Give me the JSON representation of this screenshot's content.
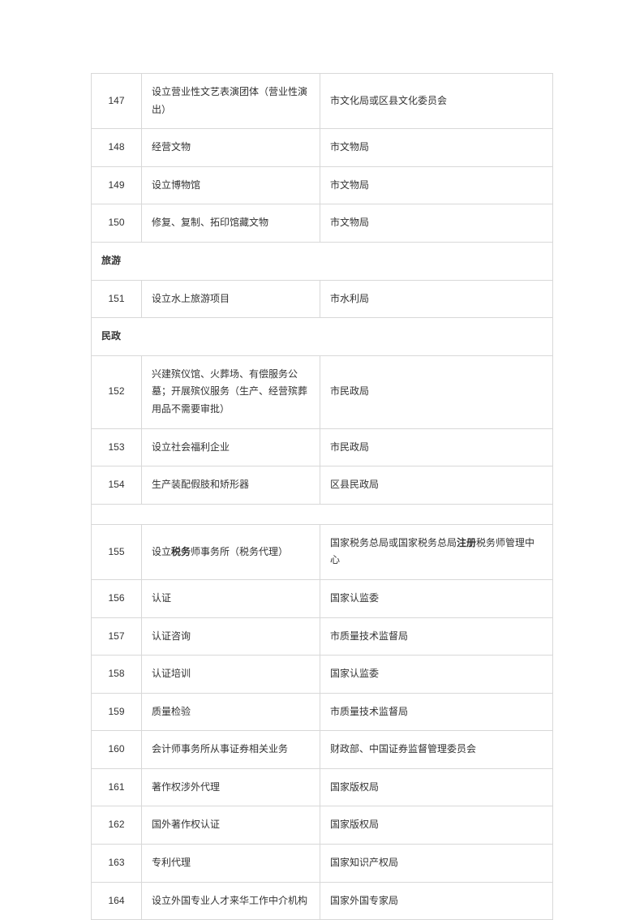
{
  "rows": [
    {
      "type": "data",
      "num": "147",
      "desc_parts": [
        {
          "t": "设立营业性文艺表演团体（营业性演出）"
        }
      ],
      "org_parts": [
        {
          "t": "市文化局或区县文化委员会"
        }
      ]
    },
    {
      "type": "data",
      "num": "148",
      "desc_parts": [
        {
          "t": "经营文物"
        }
      ],
      "org_parts": [
        {
          "t": "市文物局"
        }
      ]
    },
    {
      "type": "data",
      "num": "149",
      "desc_parts": [
        {
          "t": "设立博物馆"
        }
      ],
      "org_parts": [
        {
          "t": "市文物局"
        }
      ]
    },
    {
      "type": "data",
      "num": "150",
      "desc_parts": [
        {
          "t": "修复、复制、拓印馆藏文物"
        }
      ],
      "org_parts": [
        {
          "t": "市文物局"
        }
      ]
    },
    {
      "type": "section",
      "label": "旅游"
    },
    {
      "type": "data",
      "num": "151",
      "desc_parts": [
        {
          "t": "设立水上旅游项目"
        }
      ],
      "org_parts": [
        {
          "t": "市水利局"
        }
      ]
    },
    {
      "type": "section",
      "label": "民政"
    },
    {
      "type": "data",
      "num": "152",
      "desc_parts": [
        {
          "t": "兴建殡仪馆、火葬场、有偿服务公墓；开展殡仪服务（生产、经营殡葬用品不需要审批）"
        }
      ],
      "org_parts": [
        {
          "t": "市民政局"
        }
      ]
    },
    {
      "type": "data",
      "num": "153",
      "desc_parts": [
        {
          "t": "设立社会福利企业"
        }
      ],
      "org_parts": [
        {
          "t": "市民政局"
        }
      ]
    },
    {
      "type": "data",
      "num": "154",
      "desc_parts": [
        {
          "t": "生产装配假肢和矫形器"
        }
      ],
      "org_parts": [
        {
          "t": "区县民政局"
        }
      ]
    },
    {
      "type": "section",
      "label": ""
    },
    {
      "type": "data",
      "num": "155",
      "desc_parts": [
        {
          "t": "设立"
        },
        {
          "t": "税务",
          "b": true
        },
        {
          "t": "师事务所（税务代理）"
        }
      ],
      "org_parts": [
        {
          "t": "国家税务总局或国家税务总局"
        },
        {
          "t": "注册",
          "b": true
        },
        {
          "t": "税务师管理中心"
        }
      ]
    },
    {
      "type": "data",
      "num": "156",
      "desc_parts": [
        {
          "t": "认证"
        }
      ],
      "org_parts": [
        {
          "t": "国家认监委"
        }
      ]
    },
    {
      "type": "data",
      "num": "157",
      "desc_parts": [
        {
          "t": "认证咨询"
        }
      ],
      "org_parts": [
        {
          "t": "市质量技术监督局"
        }
      ]
    },
    {
      "type": "data",
      "num": "158",
      "desc_parts": [
        {
          "t": "认证培训"
        }
      ],
      "org_parts": [
        {
          "t": "国家认监委"
        }
      ]
    },
    {
      "type": "data",
      "num": "159",
      "desc_parts": [
        {
          "t": "质量检验"
        }
      ],
      "org_parts": [
        {
          "t": "市质量技术监督局"
        }
      ]
    },
    {
      "type": "data",
      "num": "160",
      "desc_parts": [
        {
          "t": "会计师事务所从事证券相关业务"
        }
      ],
      "org_parts": [
        {
          "t": "财政部、中国证券监督管理委员会"
        }
      ]
    },
    {
      "type": "data",
      "num": "161",
      "desc_parts": [
        {
          "t": "著作权涉外代理"
        }
      ],
      "org_parts": [
        {
          "t": "国家版权局"
        }
      ]
    },
    {
      "type": "data",
      "num": "162",
      "desc_parts": [
        {
          "t": "国外著作权认证"
        }
      ],
      "org_parts": [
        {
          "t": "国家版权局"
        }
      ]
    },
    {
      "type": "data",
      "num": "163",
      "desc_parts": [
        {
          "t": "专利代理"
        }
      ],
      "org_parts": [
        {
          "t": "国家知识产权局"
        }
      ]
    },
    {
      "type": "data",
      "num": "164",
      "desc_parts": [
        {
          "t": "设立外国专业人才来华工作中介机构"
        }
      ],
      "org_parts": [
        {
          "t": "国家外国专家局"
        }
      ]
    }
  ]
}
